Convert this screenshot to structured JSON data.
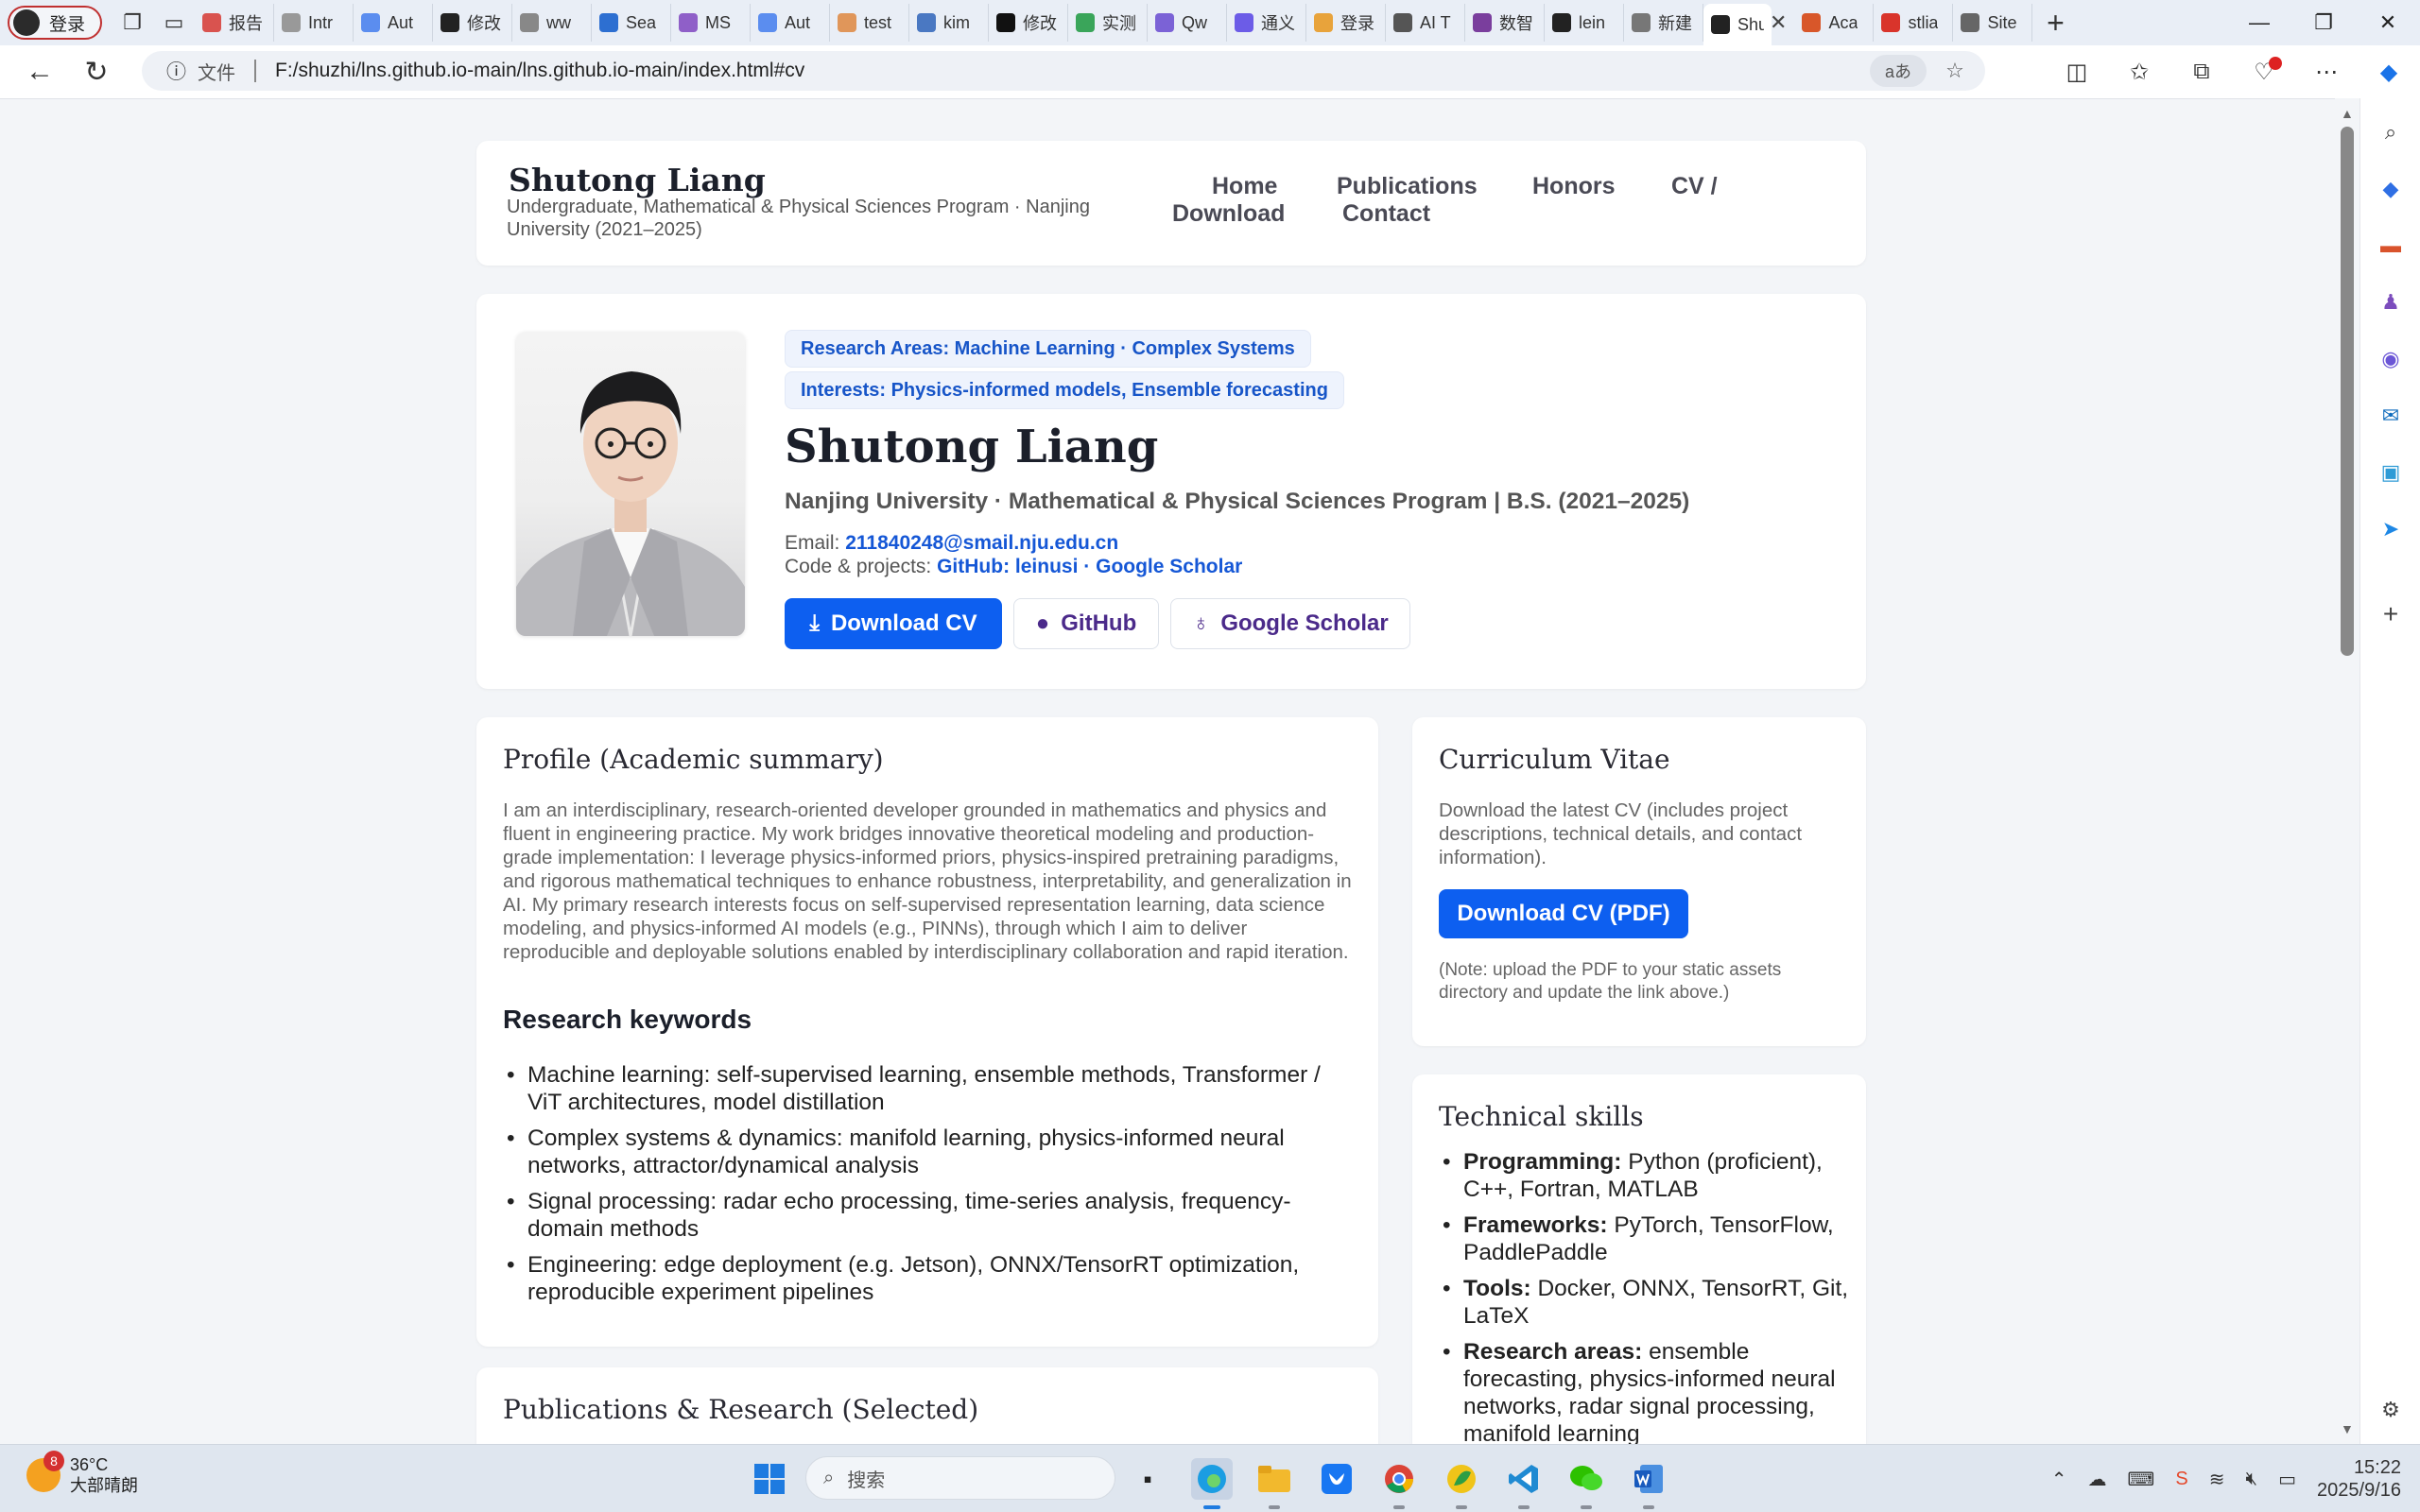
{
  "browser": {
    "profile_label": "登录",
    "tabs": [
      {
        "title": "报告",
        "color": "#d9534f"
      },
      {
        "title": "Intr",
        "color": "#999999"
      },
      {
        "title": "Aut",
        "color": "#5b8def"
      },
      {
        "title": "修改",
        "color": "#222222"
      },
      {
        "title": "ww",
        "color": "#888888"
      },
      {
        "title": "Sea",
        "color": "#2d6fd1"
      },
      {
        "title": "MS",
        "color": "#8f5fc8"
      },
      {
        "title": "Aut",
        "color": "#5b8def"
      },
      {
        "title": "test",
        "color": "#e0965a"
      },
      {
        "title": "kim",
        "color": "#4a78c2"
      },
      {
        "title": "修改",
        "color": "#111111"
      },
      {
        "title": "实测",
        "color": "#3aa55a"
      },
      {
        "title": "Qw",
        "color": "#7b62d6"
      },
      {
        "title": "通义",
        "color": "#6c5ce7"
      },
      {
        "title": "登录",
        "color": "#e8a33b"
      },
      {
        "title": "AI T",
        "color": "#555555"
      },
      {
        "title": "数智",
        "color": "#7a3e9d"
      },
      {
        "title": "lein",
        "color": "#222222"
      },
      {
        "title": "新建",
        "color": "#777777"
      },
      {
        "title": "Shu",
        "color": "#222222"
      },
      {
        "title": "Aca",
        "color": "#d8572a"
      },
      {
        "title": "stlia",
        "color": "#d9342b"
      },
      {
        "title": "Site",
        "color": "#666666"
      }
    ],
    "address": {
      "info_label": "文件",
      "url": "F:/shuzhi/lns.github.io-main/lns.github.io-main/index.html#cv",
      "read_aloud": "aあ"
    }
  },
  "site": {
    "name": "Shutong Liang",
    "subtitle": "Undergraduate, Mathematical & Physical Sciences Program · Nanjing University (2021–2025)",
    "nav": {
      "home": "Home",
      "publications": "Publications",
      "honors": "Honors",
      "cv": "CV /",
      "download": "Download",
      "contact": "Contact"
    }
  },
  "hero": {
    "research_pill": "Research Areas: Machine Learning · Complex Systems",
    "interests_pill": "Interests: Physics-informed models, Ensemble forecasting",
    "name": "Shutong Liang",
    "affiliation": "Nanjing University · Mathematical & Physical Sciences Program | B.S. (2021–2025)",
    "email_label": "Email:",
    "email": "211840248@smail.nju.edu.cn",
    "code_label": "Code & projects:",
    "github_link": "GitHub: leinusi",
    "dot_sep": "·",
    "scholar_link": "Google Scholar",
    "buttons": {
      "download_cv": "Download CV",
      "github": "GitHub",
      "scholar": "Google Scholar"
    }
  },
  "profile": {
    "title": "Profile (Academic summary)",
    "summary": "I am an interdisciplinary, research-oriented developer grounded in mathematics and physics and fluent in engineering practice. My work bridges innovative theoretical modeling and production-grade implementation: I leverage physics-informed priors, physics-inspired pretraining paradigms, and rigorous mathematical techniques to enhance robustness, interpretability, and generalization in AI. My primary research interests focus on self-supervised representation learning, data science modeling, and physics-informed AI models (e.g., PINNs), through which I aim to deliver reproducible and deployable solutions enabled by interdisciplinary collaboration and rapid iteration.",
    "keywords_title": "Research keywords",
    "keywords": [
      "Machine learning: self-supervised learning, ensemble methods, Transformer / ViT architectures, model distillation",
      "Complex systems & dynamics: manifold learning, physics-informed neural networks, attractor/dynamical analysis",
      "Signal processing: radar echo processing, time-series analysis, frequency-domain methods",
      "Engineering: edge deployment (e.g. Jetson), ONNX/TensorRT optimization, reproducible experiment pipelines"
    ]
  },
  "publications": {
    "title": "Publications & Research (Selected)"
  },
  "cv": {
    "title": "Curriculum Vitae",
    "description": "Download the latest CV (includes project descriptions, technical details, and contact information).",
    "button": "Download CV (PDF)",
    "note": "(Note: upload the PDF to your static assets directory and update the link above.)"
  },
  "skills": {
    "title": "Technical skills",
    "items": [
      {
        "label": "Programming:",
        "text": "Python (proficient), C++, Fortran, MATLAB"
      },
      {
        "label": "Frameworks:",
        "text": "PyTorch, TensorFlow, PaddlePaddle"
      },
      {
        "label": "Tools:",
        "text": "Docker, ONNX, TensorRT, Git, LaTeX"
      },
      {
        "label": "Research areas:",
        "text": "ensemble forecasting, physics-informed neural networks, radar signal processing, manifold learning"
      }
    ]
  },
  "taskbar": {
    "weather_badge": "8",
    "temperature": "36°C",
    "weather": "大部晴朗",
    "search_placeholder": "搜索",
    "time": "15:22",
    "date": "2025/9/16"
  },
  "colors": {
    "accent": "#0d5ff0",
    "link": "#1557d6",
    "page_bg": "#f3f5f8"
  }
}
